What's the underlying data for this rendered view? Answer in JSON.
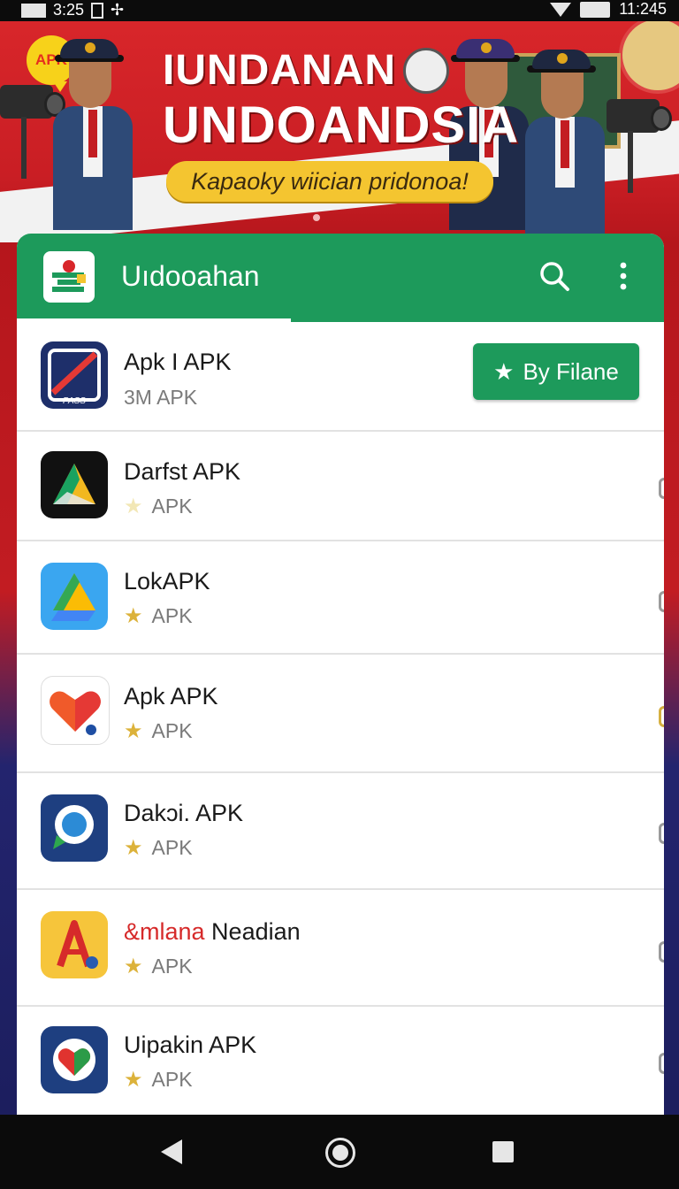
{
  "status_bar": {
    "left_text": "3:25",
    "time": "11:245"
  },
  "banner": {
    "badge": "APK",
    "headline_line1": "IUNDANAN",
    "headline_line2": "UNDOANDSIA",
    "tagline": "Kapaoky wiician pridonoa!"
  },
  "appbar": {
    "title": "Uıdooahan"
  },
  "colors": {
    "brand_green": "#1d9a5b",
    "banner_red": "#d8262a",
    "star": "#dcb23a"
  },
  "apps": [
    {
      "name": "Apk I APK",
      "sub": "3M APK",
      "icon": "pass-app-icon",
      "button": "By Filane"
    },
    {
      "name": "Darfst APK",
      "sub": "APK",
      "icon": "triangle-app-icon"
    },
    {
      "name": "LokAPK",
      "sub": "APK",
      "icon": "drive-app-icon"
    },
    {
      "name": "Apk APK",
      "sub": "APK",
      "icon": "heart-map-app-icon"
    },
    {
      "name": "Dakɔi. APK",
      "sub": "APK",
      "icon": "location-app-icon"
    },
    {
      "name_prefix": "&mlana",
      "name_rest": " Neadian",
      "sub": "APK",
      "icon": "letter-a-app-icon"
    },
    {
      "name": "Uipakin APK",
      "sub": "APK",
      "icon": "heart-shield-app-icon"
    }
  ],
  "nav": {
    "back": "back-icon",
    "home": "home-icon",
    "recent": "recent-apps-icon"
  }
}
